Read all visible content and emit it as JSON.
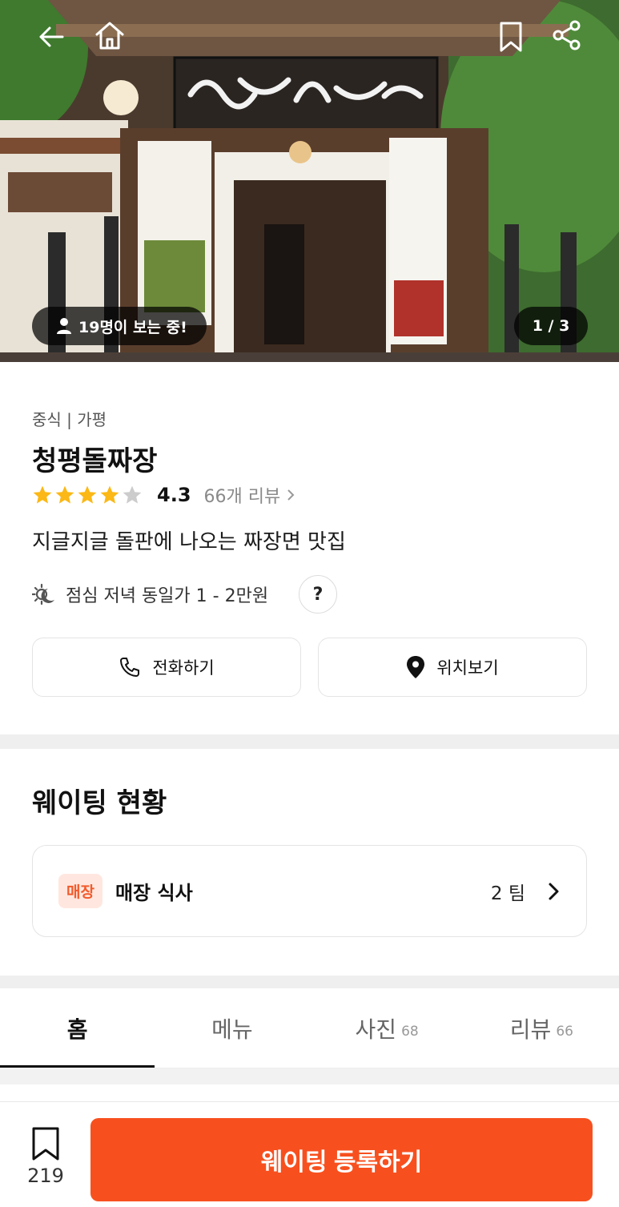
{
  "header": {
    "icons": [
      "back-arrow-icon",
      "home-icon",
      "bookmark-icon",
      "share-icon"
    ],
    "viewer_badge": "19명이 보는 중!",
    "page_indicator": "1 / 3"
  },
  "restaurant": {
    "category": "중식 | 가평",
    "name": "청평돌짜장",
    "rating": "4.3",
    "rating_stars": 4.3,
    "review_link": "66개 리뷰",
    "description": "지글지글 돌판에 나오는 짜장면 맛집",
    "price": "점심 저녁 동일가 1 - 2만원",
    "help_label": "?"
  },
  "actions": {
    "call_label": "전화하기",
    "location_label": "위치보기"
  },
  "waiting": {
    "section_title": "웨이팅 현황",
    "tag": "매장",
    "label": "매장 식사",
    "teams": "2 팀"
  },
  "tabs": [
    {
      "label": "홈",
      "count": "",
      "active": true
    },
    {
      "label": "메뉴",
      "count": "",
      "active": false
    },
    {
      "label": "사진",
      "count": "68",
      "active": false
    },
    {
      "label": "리뷰",
      "count": "66",
      "active": false
    }
  ],
  "bottom": {
    "save_count": "219",
    "cta_label": "웨이팅 등록하기"
  },
  "colors": {
    "accent": "#f7501e",
    "star": "#fbb816",
    "star_empty": "#cccccc",
    "tag_bg": "#ffe7df",
    "tag_text": "#f25a2c"
  }
}
